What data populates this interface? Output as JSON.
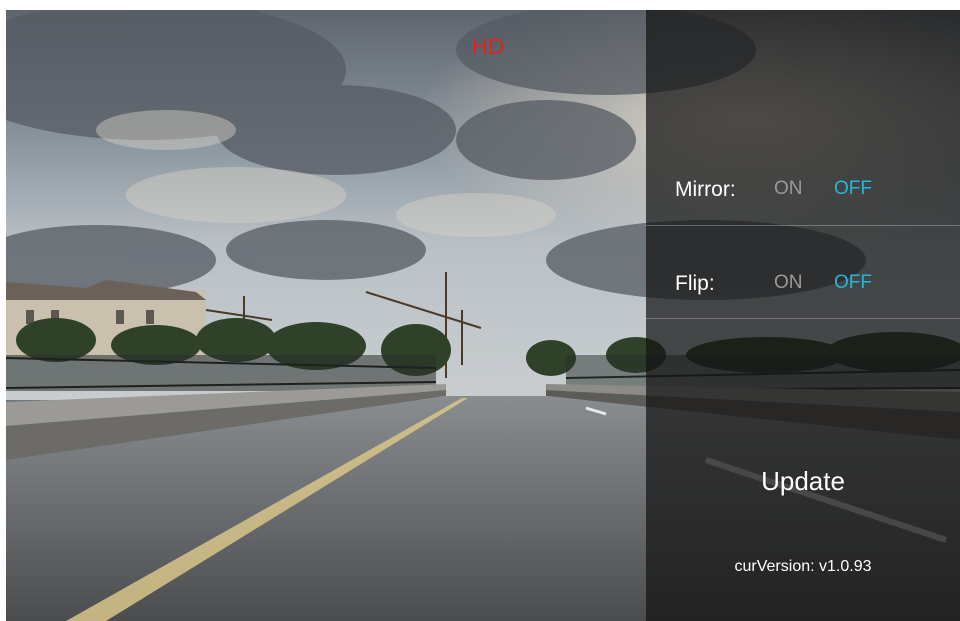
{
  "overlay": {
    "badge": "HD"
  },
  "settings": {
    "mirror": {
      "label": "Mirror:",
      "on_label": "ON",
      "off_label": "OFF",
      "selected": "OFF"
    },
    "flip": {
      "label": "Flip:",
      "on_label": "ON",
      "off_label": "OFF",
      "selected": "OFF"
    }
  },
  "update": {
    "label": "Update",
    "version": "curVersion: v1.0.93"
  },
  "colors": {
    "badge": "#e0231b",
    "selected_option": "#25b8d9",
    "unselected_option": "#9a9a9a",
    "panel": "#141414"
  }
}
